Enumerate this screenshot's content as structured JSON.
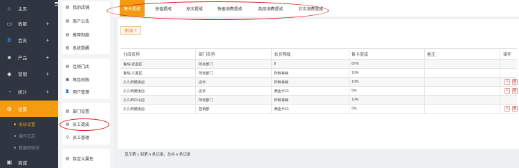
{
  "sidebar": {
    "items": [
      {
        "label": "主页",
        "icon": "home-icon",
        "glyph": "⌂",
        "plus": ""
      },
      {
        "label": "收银",
        "icon": "monitor-icon",
        "glyph": "▭",
        "plus": "+"
      },
      {
        "label": "会员",
        "icon": "user-icon",
        "glyph": "👤",
        "plus": "+"
      },
      {
        "label": "产品",
        "icon": "box-icon",
        "glyph": "■",
        "plus": "+"
      },
      {
        "label": "营销",
        "icon": "tag-icon",
        "glyph": "◆",
        "plus": "+"
      },
      {
        "label": "统计",
        "icon": "pie-chart-icon",
        "glyph": "◔",
        "plus": "+"
      },
      {
        "label": "设置",
        "icon": "gear-icon",
        "glyph": "⚙",
        "plus": "-"
      }
    ],
    "sub_items": [
      "系统设置",
      "操作日志",
      "数据回收站"
    ],
    "bottom_item": {
      "label": "商城",
      "icon": "shop-icon",
      "glyph": "▣"
    }
  },
  "panel": {
    "groups": [
      [
        {
          "label": "我的店铺",
          "icon": "store-icon",
          "glyph": "▤"
        },
        {
          "label": "商户公告",
          "icon": "notice-icon",
          "glyph": "▤"
        },
        {
          "label": "推荐制度",
          "icon": "referral-icon",
          "glyph": "▤"
        },
        {
          "label": "系统提醒",
          "icon": "bell-icon",
          "glyph": "▤"
        }
      ],
      [
        {
          "label": "连锁门店",
          "icon": "chain-store-icon",
          "glyph": "▤"
        },
        {
          "label": "角色权限",
          "icon": "lock-icon",
          "glyph": "▣"
        },
        {
          "label": "用户管理",
          "icon": "user-icon",
          "glyph": "👤"
        }
      ],
      [
        {
          "label": "部门设置",
          "icon": "department-icon",
          "glyph": "▤"
        },
        {
          "label": "员工提成",
          "icon": "commission-icon",
          "glyph": "▤"
        },
        {
          "label": "员工管理",
          "icon": "staff-icon",
          "glyph": "⚲"
        }
      ],
      [
        {
          "label": "自定义属性",
          "icon": "custom-attr-icon",
          "glyph": "▤"
        }
      ]
    ]
  },
  "tabs": [
    "售卡提成",
    "充值提成",
    "充次提成",
    "快速消费提成",
    "商品消费提成",
    "计次消费提成"
  ],
  "add_button": {
    "label": "新增",
    "plus": "+"
  },
  "table": {
    "columns": [
      "分店名称",
      "部门名称",
      "会员等级",
      "售卡提成",
      "备注",
      "操作"
    ],
    "rows": [
      {
        "store": "鲁皖-武昌区",
        "dept": "所有部门",
        "level": "8",
        "rate": "67%",
        "note": "",
        "ops": false
      },
      {
        "store": "鲁皖-江夏区",
        "dept": "所有部门",
        "level": "所有等级",
        "rate": "10%",
        "note": "",
        "ops": false
      },
      {
        "store": "久久鲜膳饭店",
        "dept": "店长",
        "level": "所有等级",
        "rate": "10%",
        "note": "",
        "ops": true
      },
      {
        "store": "久久鲜膳饭店",
        "dept": "店长",
        "level": "黄金卡21",
        "rate": "5%",
        "note": "",
        "ops": true
      },
      {
        "store": "久久鲜中山店",
        "dept": "所有部门",
        "level": "所有等级",
        "rate": "10%",
        "note": "",
        "ops": false
      },
      {
        "store": "久久鲜膳饭店",
        "dept": "营销部",
        "level": "黄金卡21",
        "rate": "5%",
        "note": "",
        "ops": true
      }
    ]
  },
  "summary": "显示第 1 到第 6 条记录，总共 6 条记录",
  "colors": {
    "accent": "#f39c12",
    "sidebar_bg": "#2f3541",
    "annotation": "#d91e18",
    "danger": "#d9534f"
  }
}
